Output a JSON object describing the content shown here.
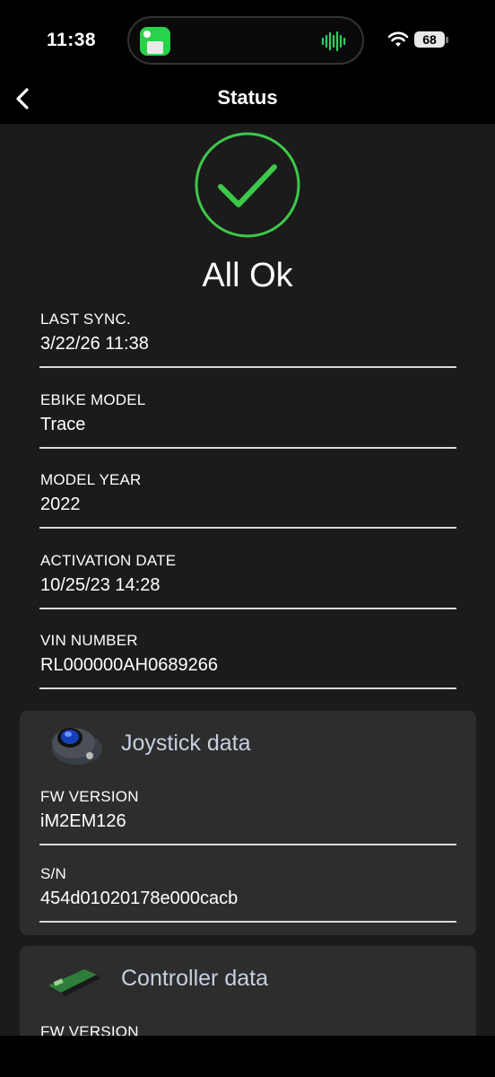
{
  "status_bar": {
    "time": "11:38",
    "battery": "68",
    "wifi_icon": "wifi-icon",
    "activity_icon": "audio-wave-icon"
  },
  "nav": {
    "title": "Status",
    "back_icon": "chevron-left-icon"
  },
  "status": {
    "icon": "checkmark-circle-icon",
    "text": "All Ok",
    "accent_color": "#3ec84a"
  },
  "fields": [
    {
      "label": "LAST SYNC.",
      "value": "3/22/26 11:38"
    },
    {
      "label": "EBIKE MODEL",
      "value": "Trace"
    },
    {
      "label": "MODEL YEAR",
      "value": "2022"
    },
    {
      "label": "ACTIVATION DATE",
      "value": "10/25/23 14:28"
    },
    {
      "label": "VIN NUMBER",
      "value": "RL000000AH0689266"
    }
  ],
  "joystick": {
    "title": "Joystick data",
    "fields": [
      {
        "label": "FW VERSION",
        "value": "iM2EM126"
      },
      {
        "label": "S/N",
        "value": "454d01020178e000cacb"
      }
    ]
  },
  "controller": {
    "title": "Controller data",
    "fields": [
      {
        "label": "FW VERSION",
        "value": ""
      }
    ]
  }
}
